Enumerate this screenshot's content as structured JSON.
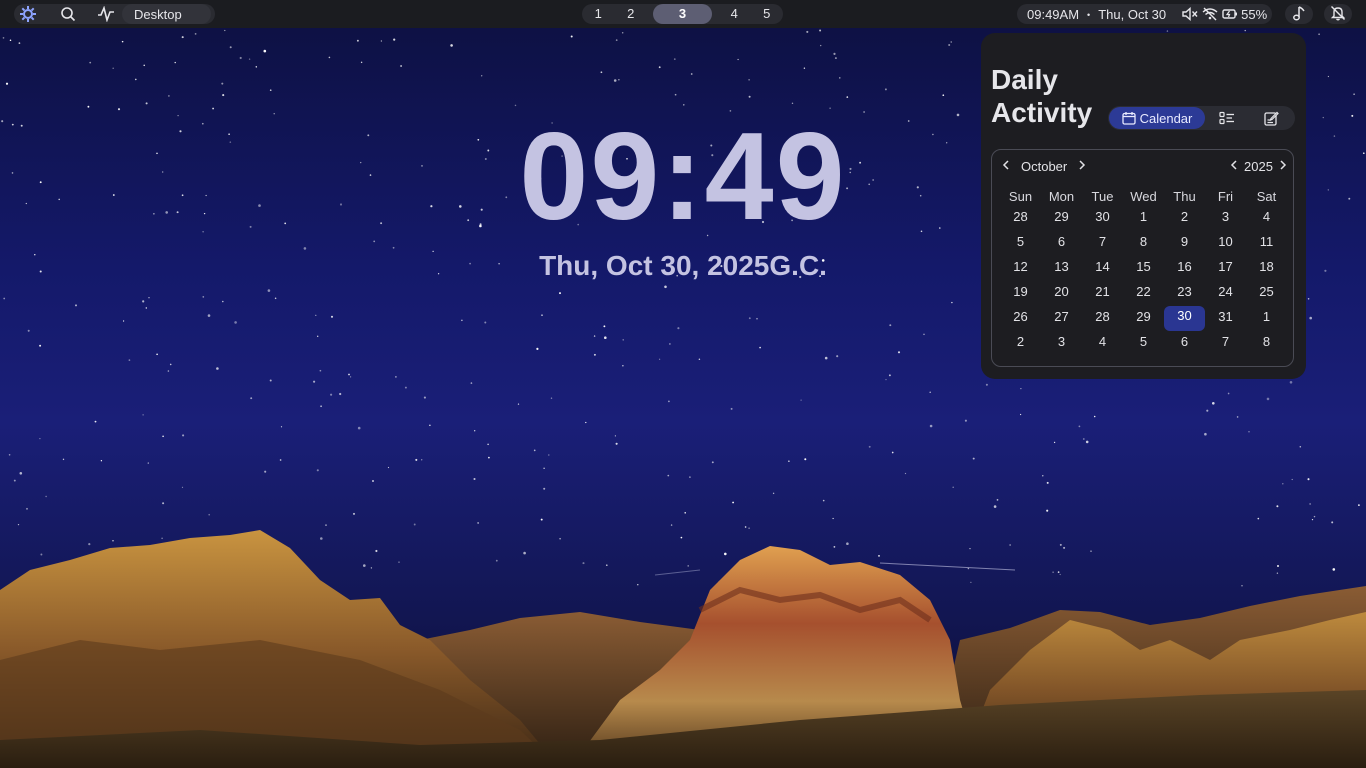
{
  "topbar": {
    "workspace_label": "Desktop",
    "workspaces": [
      "1",
      "2",
      "3",
      "4",
      "5"
    ],
    "active_workspace": "3",
    "time": "09:49AM",
    "date": "Thu, Oct 30",
    "separator": "•",
    "battery": "55%",
    "icons": [
      "app-launcher-icon",
      "search-icon",
      "activity-icon",
      "volume-muted-icon",
      "wifi-off-icon",
      "battery-icon",
      "music-note-icon",
      "notifications-off-icon"
    ]
  },
  "desktop": {
    "clock": "09:49",
    "date": "Thu, Oct 30, 2025G.C."
  },
  "widget": {
    "title": "Daily Activity",
    "tabs": {
      "calendar_label": "Calendar",
      "active": "Calendar"
    },
    "calendar": {
      "month": "October",
      "year": "2025",
      "day_headers": [
        "Sun",
        "Mon",
        "Tue",
        "Wed",
        "Thu",
        "Fri",
        "Sat"
      ],
      "weeks": [
        [
          "28",
          "29",
          "30",
          "1",
          "2",
          "3",
          "4"
        ],
        [
          "5",
          "6",
          "7",
          "8",
          "9",
          "10",
          "11"
        ],
        [
          "12",
          "13",
          "14",
          "15",
          "16",
          "17",
          "18"
        ],
        [
          "19",
          "20",
          "21",
          "22",
          "23",
          "24",
          "25"
        ],
        [
          "26",
          "27",
          "28",
          "29",
          "30",
          "31",
          "1"
        ],
        [
          "2",
          "3",
          "4",
          "5",
          "6",
          "7",
          "8"
        ]
      ],
      "today": "30"
    }
  },
  "colors": {
    "accent": "#2a3692",
    "clock": "#c4c3e2",
    "bar": "#1b1c20"
  }
}
